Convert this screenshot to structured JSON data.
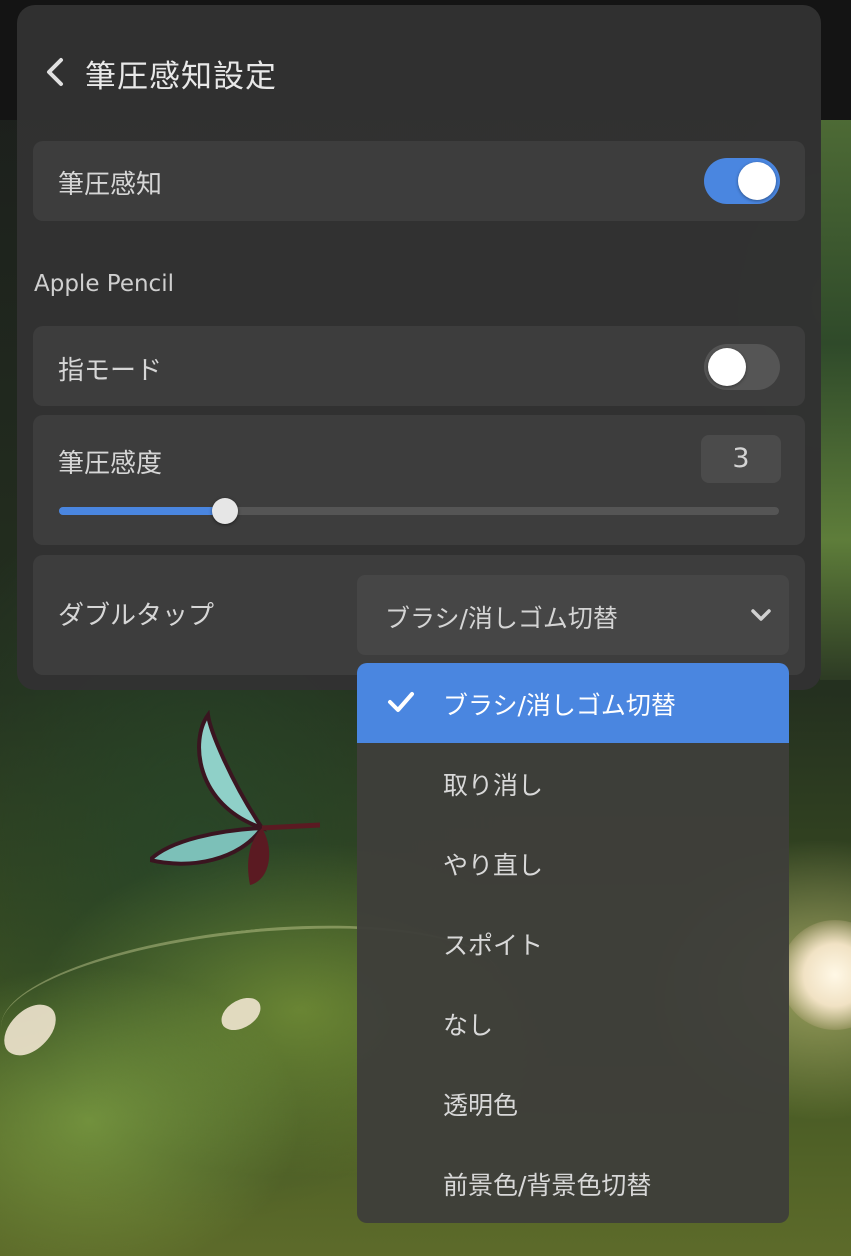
{
  "header": {
    "title": "筆圧感知設定"
  },
  "pressure_toggle": {
    "label": "筆圧感知",
    "on": true
  },
  "section": {
    "label": "Apple Pencil"
  },
  "finger_mode": {
    "label": "指モード",
    "on": false
  },
  "sensitivity": {
    "label": "筆圧感度",
    "value": "3",
    "level": 0.23
  },
  "double_tap": {
    "label": "ダブルタップ",
    "selected": "ブラシ/消しゴム切替",
    "options": [
      "ブラシ/消しゴム切替",
      "取り消し",
      "やり直し",
      "スポイト",
      "なし",
      "透明色",
      "前景色/背景色切替"
    ]
  },
  "colors": {
    "accent": "#4a86e0",
    "panel": "#323232",
    "row": "#3d3d3d"
  }
}
